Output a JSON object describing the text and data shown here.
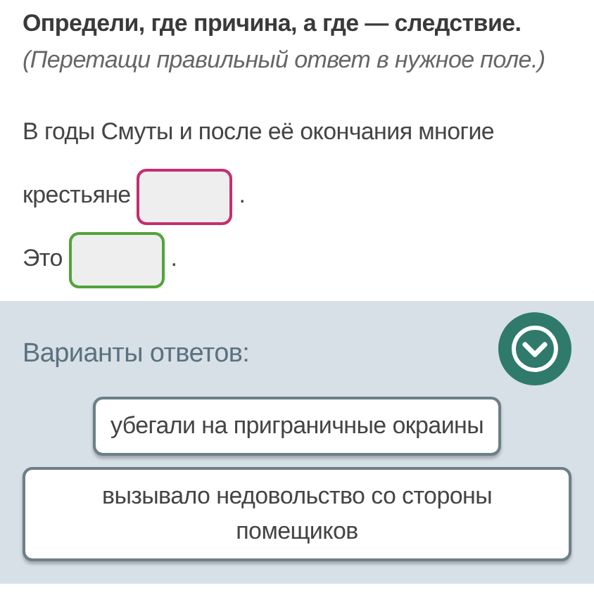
{
  "task": {
    "title": "Определи, где причина, а где — следствие.",
    "hint": "(Перетащи правильный ответ в нужное поле.)"
  },
  "sentences": [
    {
      "parts": [
        {
          "kind": "text",
          "text": "В годы Смуты и после её окончания многие"
        },
        {
          "kind": "text",
          "text": "крестьяне"
        },
        {
          "kind": "slot",
          "color": "#c2306e"
        },
        {
          "kind": "text",
          "text": "."
        }
      ]
    },
    {
      "parts": [
        {
          "kind": "text",
          "text": "Это"
        },
        {
          "kind": "slot",
          "color": "#52a33c"
        },
        {
          "kind": "text",
          "text": "."
        }
      ]
    }
  ],
  "answers": {
    "heading": "Варианты ответов:",
    "options": [
      "убегали на приграничные окраины",
      "вызывало недовольство со стороны помещиков"
    ]
  }
}
